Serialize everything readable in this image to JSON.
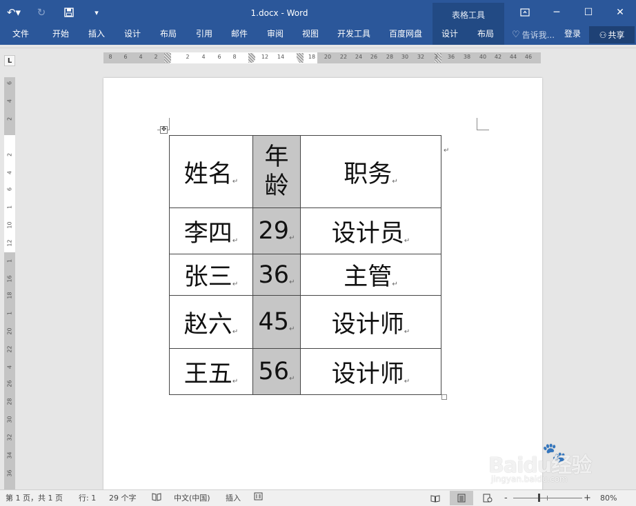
{
  "titlebar": {
    "title": "1.docx - Word",
    "context_title": "表格工具",
    "undo_icon": "undo-icon",
    "redo_icon": "redo-icon",
    "save_icon": "save-icon",
    "customize_icon": "customize-qat-icon"
  },
  "ribbon": {
    "tabs": [
      "文件",
      "开始",
      "插入",
      "设计",
      "布局",
      "引用",
      "邮件",
      "审阅",
      "视图",
      "开发工具",
      "百度网盘"
    ],
    "context_tabs": [
      "设计",
      "布局"
    ],
    "tell_me": "告诉我...",
    "login": "登录",
    "share": "共享"
  },
  "ruler": {
    "h_ticks": [
      "8",
      "6",
      "4",
      "2",
      "2",
      "4",
      "6",
      "8",
      "12",
      "14",
      "18",
      "20",
      "22",
      "24",
      "26",
      "28",
      "30",
      "32",
      "3",
      "36",
      "38",
      "40",
      "42",
      "44",
      "46"
    ],
    "v_ticks": [
      "6",
      "4",
      "2",
      "2",
      "4",
      "6",
      "1",
      "10",
      "12",
      "1",
      "16",
      "18",
      "1",
      "20",
      "22",
      "4",
      "26",
      "28",
      "30",
      "32",
      "34",
      "36",
      "38",
      "40"
    ]
  },
  "table": {
    "rows": [
      [
        "姓名",
        "年龄",
        "职务"
      ],
      [
        "李四",
        "29",
        "设计员"
      ],
      [
        "张三",
        "36",
        "主管"
      ],
      [
        "赵六",
        "45",
        "设计师"
      ],
      [
        "王五",
        "56",
        "设计师"
      ]
    ],
    "paragraph_mark": "↵"
  },
  "status": {
    "page": "第 1 页，共 1 页",
    "line": "行: 1",
    "words": "29 个字",
    "language": "中文(中国)",
    "mode": "插入",
    "zoom": "80%",
    "zoom_minus": "-",
    "zoom_plus": "+"
  },
  "watermark": {
    "text": "Baidu经验",
    "sub": "jingyan.baidu.com"
  }
}
